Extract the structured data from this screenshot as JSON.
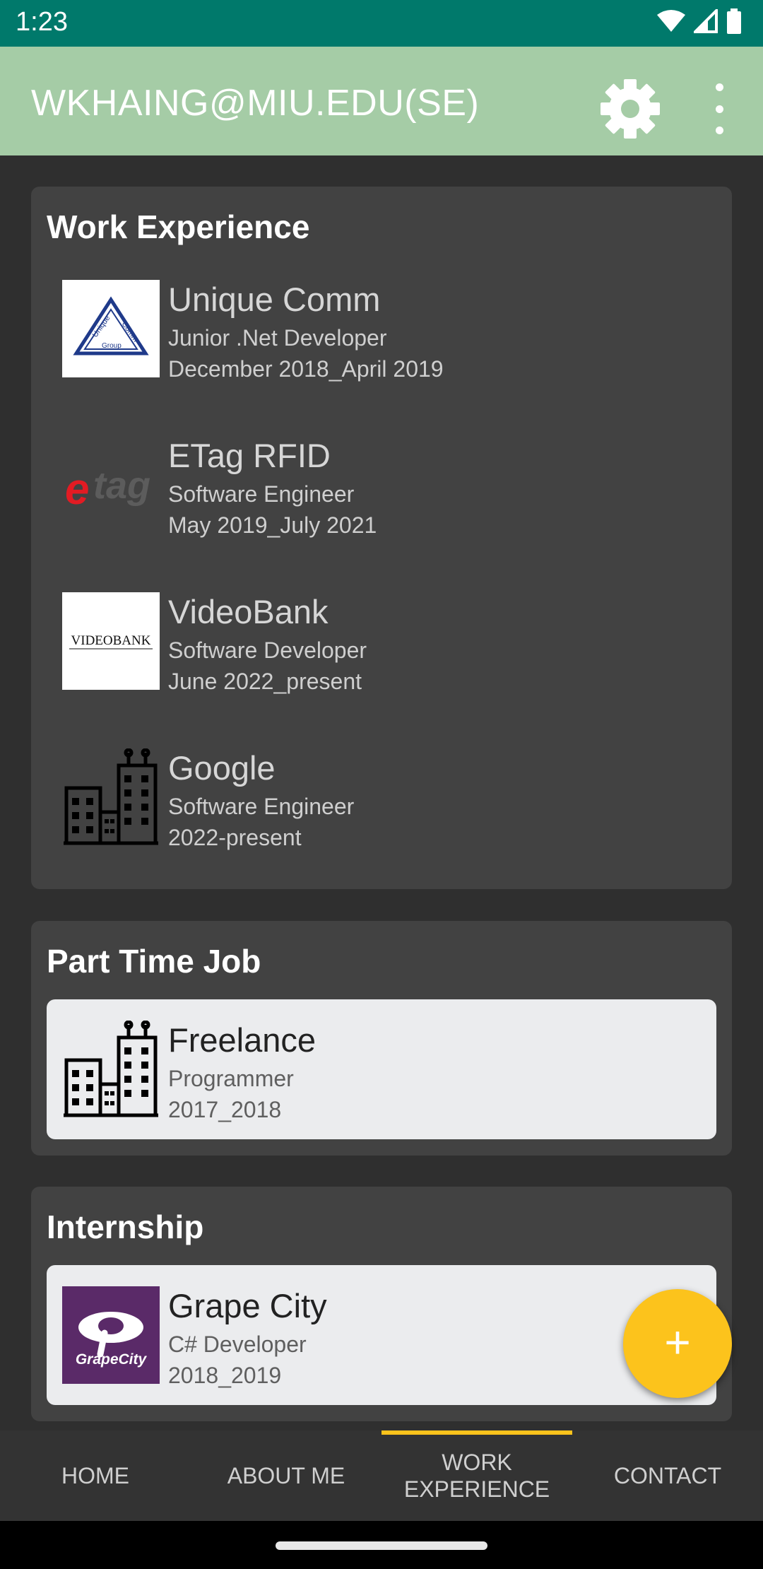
{
  "status": {
    "time": "1:23"
  },
  "appbar": {
    "title": "WKHAING@MIU.EDU(SE)"
  },
  "work_experience": {
    "title": "Work Experience",
    "jobs": [
      {
        "company": "Unique Comm",
        "role": "Junior .Net Developer",
        "dates": "December 2018_April 2019",
        "logo": "unique-comm-logo"
      },
      {
        "company": "ETag RFID",
        "role": "Software Engineer",
        "dates": "May 2019_July 2021",
        "logo": "etag-logo"
      },
      {
        "company": "VideoBank",
        "role": "Software Developer",
        "dates": "June 2022_present",
        "logo": "videobank-logo"
      },
      {
        "company": "Google",
        "role": "Software Engineer",
        "dates": "2022-present",
        "logo": "buildings-icon"
      }
    ]
  },
  "part_time": {
    "title": "Part Time Job",
    "job": {
      "company": "Freelance",
      "role": "Programmer",
      "dates": "2017_2018",
      "logo": "buildings-icon"
    }
  },
  "internship": {
    "title": "Internship",
    "job": {
      "company": "Grape City",
      "role": "C# Developer",
      "dates": "2018_2019",
      "logo": "grapecity-logo"
    }
  },
  "logos": {
    "unique": {
      "line1": "Unique",
      "line2": "Comm",
      "line3": "Group"
    },
    "etag": {
      "text": "etag"
    },
    "videobank": {
      "text": "VIDEOBANK"
    },
    "grapecity": {
      "text": "GrapeCity"
    }
  },
  "fab": {
    "symbol": "+"
  },
  "tabs": [
    {
      "label": "HOME"
    },
    {
      "label": "ABOUT ME"
    },
    {
      "label": "WORK\nEXPERIENCE"
    },
    {
      "label": "CONTACT"
    }
  ],
  "colors": {
    "statusbar": "#00796b",
    "appbar": "#a5cca6",
    "accent": "#fcc31c",
    "background": "#2f2f2f",
    "card": "#424242"
  }
}
